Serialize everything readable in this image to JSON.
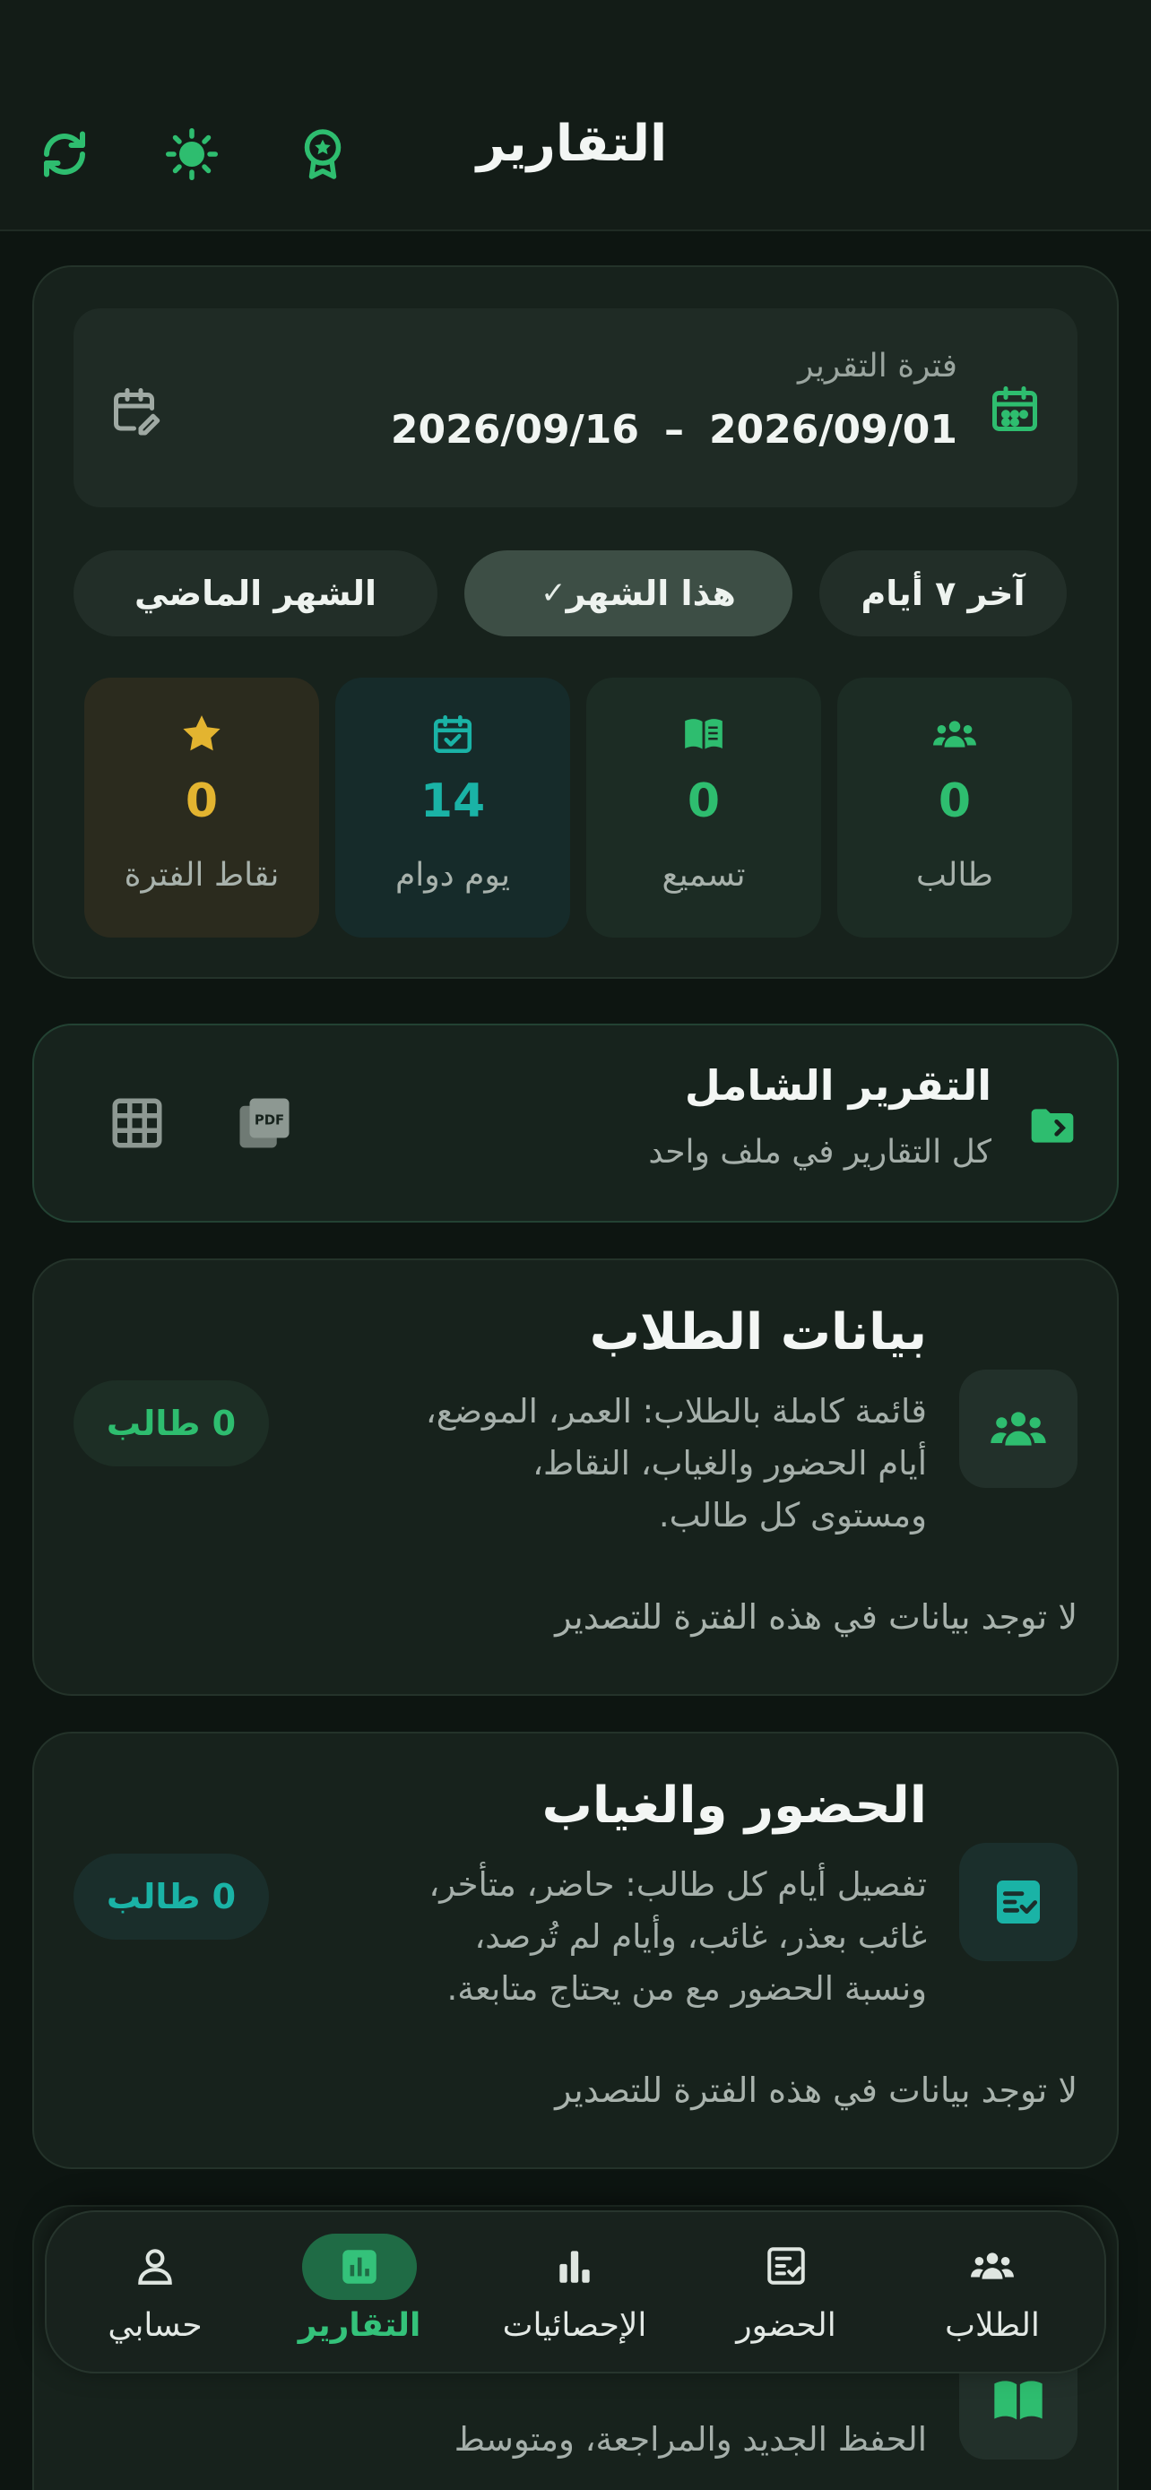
{
  "header": {
    "title": "التقارير"
  },
  "period": {
    "label": "فترة التقرير",
    "from": "2026/09/01",
    "to": "2026/09/16",
    "separator": "–"
  },
  "filters": [
    {
      "label": "آخر ٧ أيام",
      "active": false
    },
    {
      "label": "هذا الشهر",
      "active": true
    },
    {
      "label": "الشهر الماضي",
      "active": false
    }
  ],
  "stats": [
    {
      "value": "0",
      "label": "طالب",
      "icon": "users-icon",
      "color": "#2ebd6f"
    },
    {
      "value": "0",
      "label": "تسميع",
      "icon": "book-icon",
      "color": "#2ebd6f"
    },
    {
      "value": "14",
      "label": "يوم دوام",
      "icon": "calendar-check-icon",
      "color": "#1ab3a6"
    },
    {
      "value": "0",
      "label": "نقاط الفترة",
      "icon": "star-icon",
      "color": "#e3b430"
    }
  ],
  "comprehensive": {
    "title": "التقرير الشامل",
    "subtitle": "كل التقارير في ملف واحد",
    "pdf_icon_text": "PDF"
  },
  "reports": [
    {
      "title": "بيانات الطلاب",
      "desc_lines": [
        "قائمة كاملة بالطلاب: العمر، الموضع،",
        "أيام الحضور والغياب، النقاط،",
        "ومستوى كل طالب."
      ],
      "badge": "0 طالب",
      "empty": "لا توجد بيانات في هذه الفترة للتصدير"
    },
    {
      "title": "الحضور والغياب",
      "desc_lines": [
        "تفصيل أيام كل طالب: حاضر، متأخر،",
        "غائب بعذر، غائب، وأيام لم تُرصد،",
        "ونسبة الحضور مع من يحتاج متابعة."
      ],
      "badge": "0 طالب",
      "empty": "لا توجد بيانات في هذه الفترة للتصدير"
    },
    {
      "desc_lines": [
        "الحفظ الجديد والمراجعة، ومتوسط"
      ]
    }
  ],
  "nav": [
    {
      "label": "الطلاب",
      "icon": "users-icon",
      "active": false
    },
    {
      "label": "الحضور",
      "icon": "checklist-icon",
      "active": false
    },
    {
      "label": "الإحصائيات",
      "icon": "bar-chart-icon",
      "active": false
    },
    {
      "label": "التقارير",
      "icon": "report-icon",
      "active": true
    },
    {
      "label": "حسابي",
      "icon": "person-icon",
      "active": false
    }
  ],
  "colors": {
    "accent": "#2ebd6f",
    "teal": "#1ab3a6",
    "gold": "#e3b430"
  }
}
